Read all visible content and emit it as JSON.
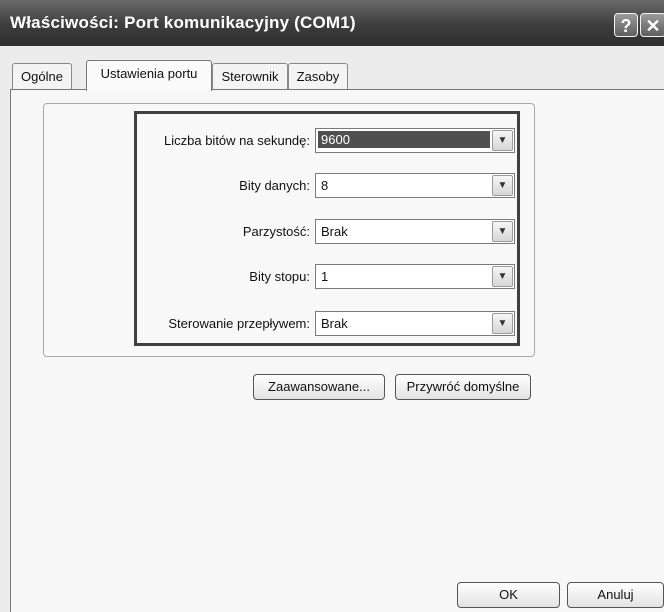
{
  "window": {
    "title": "Właściwości: Port komunikacyjny (COM1)",
    "help": "?",
    "close": "✕"
  },
  "tabs": [
    {
      "label": "Ogólne",
      "active": false
    },
    {
      "label": "Ustawienia portu",
      "active": true
    },
    {
      "label": "Sterownik",
      "active": false
    },
    {
      "label": "Zasoby",
      "active": false
    }
  ],
  "settings": [
    {
      "label": "Liczba bitów na sekundę:",
      "value": "9600",
      "selected": true
    },
    {
      "label": "Bity danych:",
      "value": "8",
      "selected": false
    },
    {
      "label": "Parzystość:",
      "value": "Brak",
      "selected": false
    },
    {
      "label": "Bity stopu:",
      "value": "1",
      "selected": false
    },
    {
      "label": "Sterowanie przepływem:",
      "value": "Brak",
      "selected": false
    }
  ],
  "buttons": {
    "advanced": "Zaawansowane...",
    "restore_defaults": "Przywróć domyślne",
    "ok": "OK",
    "cancel": "Anuluj"
  },
  "icons": {
    "dropdown_arrow": "chevron-down-icon",
    "close": "close-icon",
    "help": "help-icon"
  }
}
